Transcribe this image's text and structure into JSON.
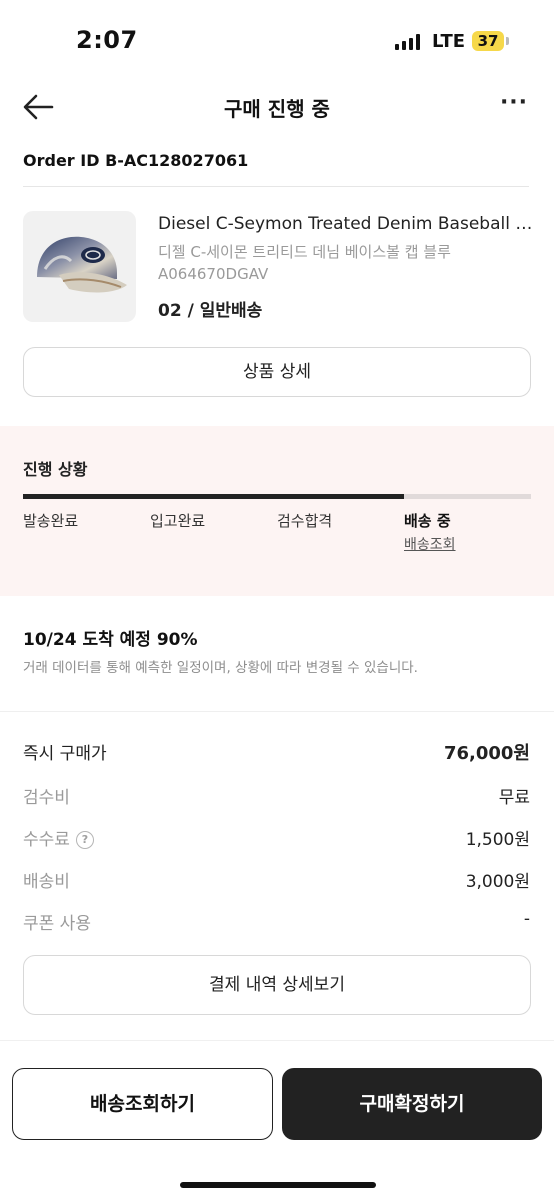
{
  "status_bar": {
    "time": "2:07",
    "network": "LTE",
    "battery": "37",
    "battery_color": "#f6d84a"
  },
  "header": {
    "title": "구매 진행 중",
    "back_icon": "arrow-left-icon",
    "more_icon": "more-horizontal-icon",
    "more_label": "···"
  },
  "order": {
    "id_text": "Order ID B-AC128027061"
  },
  "product": {
    "name": "Diesel C-Seymon Treated Denim Baseball Cap",
    "name_kr": "디젤 C-세이몬 트리티드 데님 베이스볼 캡 블루",
    "code": "A064670DGAV",
    "option": "02 / 일반배송",
    "detail_button": "상품 상세"
  },
  "progress": {
    "title": "진행 상황",
    "fraction": 0.75,
    "steps": [
      "발송완료",
      "입고완료",
      "검수합격",
      "배송 중"
    ],
    "active_index": 3,
    "tracking_link": "배송조회"
  },
  "arrival": {
    "estimate": "10/24 도착 예정 90%",
    "note": "거래 데이터를 통해 예측한 일정이며, 상황에 따라 변경될 수 있습니다."
  },
  "pricing": {
    "rows": [
      {
        "label": "즉시 구매가",
        "value": "76,000원"
      },
      {
        "label": "검수비",
        "value": "무료"
      },
      {
        "label": "수수료",
        "value": "1,500원"
      },
      {
        "label": "배송비",
        "value": "3,000원"
      },
      {
        "label": "쿠폰 사용",
        "value": "-"
      }
    ],
    "help_icon": "?",
    "payment_details_button": "결제 내역 상세보기"
  },
  "actions": {
    "track_button": "배송조회하기",
    "confirm_button": "구매확정하기"
  }
}
